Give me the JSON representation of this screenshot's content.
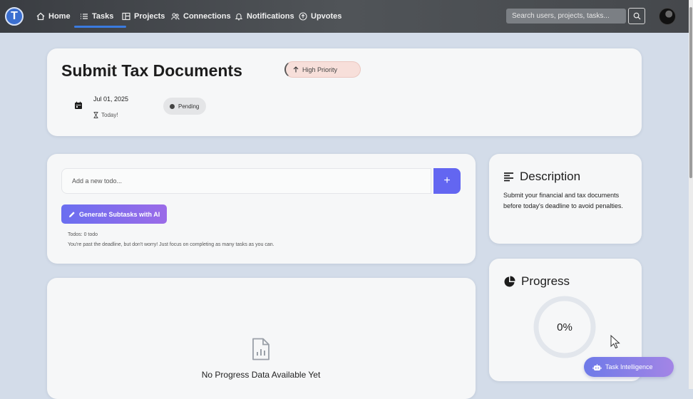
{
  "nav": {
    "logo_letter": "T",
    "items": [
      {
        "label": "Home",
        "icon": "home-icon"
      },
      {
        "label": "Tasks",
        "icon": "list-icon",
        "active": true
      },
      {
        "label": "Projects",
        "icon": "board-icon"
      },
      {
        "label": "Connections",
        "icon": "users-icon"
      },
      {
        "label": "Notifications",
        "icon": "bell-icon"
      },
      {
        "label": "Upvotes",
        "icon": "arrow-up-circle-icon"
      }
    ],
    "search_placeholder": "Search users, projects, tasks..."
  },
  "task": {
    "title": "Submit Tax Documents",
    "priority": "High Priority",
    "date": "Jul 01, 2025",
    "due_text": "Today!",
    "status": "Pending"
  },
  "todos": {
    "input_placeholder": "Add a new todo...",
    "add_label": "+",
    "generate_label": "Generate Subtasks with AI",
    "count_text": "Todos: 0 todo",
    "deadline_message": "You're past the deadline, but don't worry! Just focus on completing as many tasks as you can."
  },
  "progress_chart": {
    "empty_title": "No Progress Data Available Yet"
  },
  "description": {
    "heading": "Description",
    "text": "Submit your financial and tax documents before today's deadline to avoid penalties."
  },
  "progress": {
    "heading": "Progress",
    "percent_label": "0%",
    "value": 0
  },
  "assistant": {
    "label": "Task Intelligence"
  },
  "colors": {
    "accent": "#6366f1",
    "nav_active": "#3a7be0",
    "priority_bg": "#f7dfda",
    "ring_track": "#e2e6ec"
  }
}
